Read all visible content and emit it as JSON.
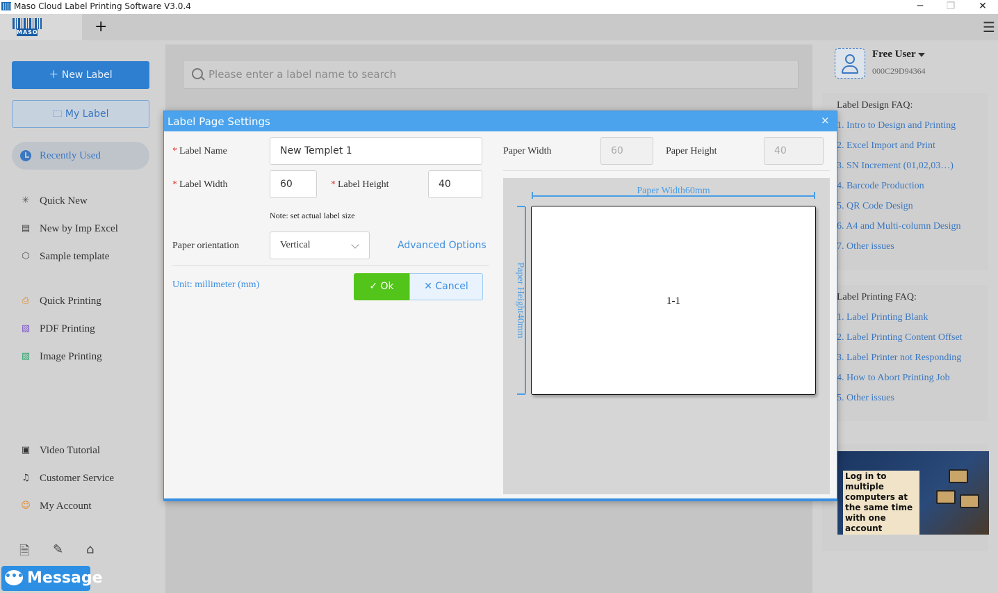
{
  "window": {
    "title": "Maso Cloud Label Printing Software V3.0.4",
    "minimize": "─",
    "maximize": "❐",
    "close": "✕"
  },
  "tabs": {
    "logo_text": "MASO",
    "add": "+",
    "menu": "☰"
  },
  "sidebar": {
    "new_label": "New Label",
    "my_label": "My Label",
    "recently_used": "Recently Used",
    "items": [
      {
        "label": "Quick New",
        "icon": "sparkle-icon"
      },
      {
        "label": "New by Imp Excel",
        "icon": "excel-icon"
      },
      {
        "label": "Sample template",
        "icon": "box-icon"
      },
      {
        "label": "Quick Printing",
        "icon": "printer-icon"
      },
      {
        "label": "PDF Printing",
        "icon": "pdf-icon"
      },
      {
        "label": "Image Printing",
        "icon": "image-icon"
      },
      {
        "label": "Video Tutorial",
        "icon": "video-icon"
      },
      {
        "label": "Customer Service",
        "icon": "headset-icon"
      },
      {
        "label": "My Account",
        "icon": "user-icon"
      }
    ],
    "message": "Message"
  },
  "search": {
    "placeholder": "Please enter a label name to search"
  },
  "user": {
    "name": "Free User",
    "id": "000C29D94364"
  },
  "faq": {
    "design_head": "Label Design FAQ:",
    "design_items": [
      "1. Intro to Design and Printing",
      "2. Excel Import and Print",
      "3. SN Increment (01,02,03…)",
      "4. Barcode Production",
      "5. QR Code Design",
      "6. A4 and Multi-column Design",
      "7. Other issues"
    ],
    "printing_head": "Label Printing FAQ:",
    "printing_items": [
      "1. Label Printing Blank",
      "2. Label Printing Content Offset",
      "3. Label Printer not Responding",
      "4. How to Abort Printing Job",
      "5. Other issues"
    ]
  },
  "promo": {
    "text": "Log in to multiple computers at the same time with one account"
  },
  "dialog": {
    "title": "Label Page Settings",
    "close": "×",
    "required_mark": "*",
    "label_name_label": "Label Name",
    "label_name_value": "New Templet 1",
    "label_width_label": "Label Width",
    "label_width_value": "60",
    "label_height_label": "Label Height",
    "label_height_value": "40",
    "note": "Note: set actual label size",
    "orientation_label": "Paper orientation",
    "orientation_value": "Vertical",
    "advanced": "Advanced Options",
    "unit": "Unit: millimeter (mm)",
    "ok": "Ok",
    "cancel": "Cancel",
    "paper_width_label": "Paper Width",
    "paper_width_value": "60",
    "paper_height_label": "Paper Height",
    "paper_height_value": "40",
    "preview_width_label": "Paper Width60mm",
    "preview_height_label": "Paper Height40mm",
    "preview_cell": "1-1"
  },
  "colors": {
    "accent": "#2f7fd0",
    "dialog_header": "#4aa3ec",
    "ok_green": "#52c41a",
    "required_red": "#e53935"
  }
}
